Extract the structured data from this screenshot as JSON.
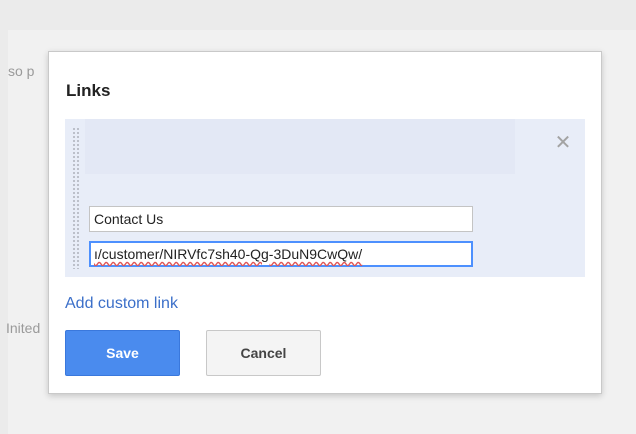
{
  "background": {
    "top_fragment": "so p",
    "bottom_fragment": "Inited"
  },
  "dialog": {
    "title": "Links",
    "close_icon": "close-icon",
    "link_item": {
      "title_value": "Contact Us",
      "url_value": "ı/customer/NIRVfc7sh40-Qg-3DuN9CwQw/"
    },
    "add_custom_link_label": "Add custom link",
    "save_label": "Save",
    "cancel_label": "Cancel"
  },
  "colors": {
    "accent": "#4a8bee",
    "link": "#3b6fc9",
    "card_background": "#e8edf8"
  }
}
